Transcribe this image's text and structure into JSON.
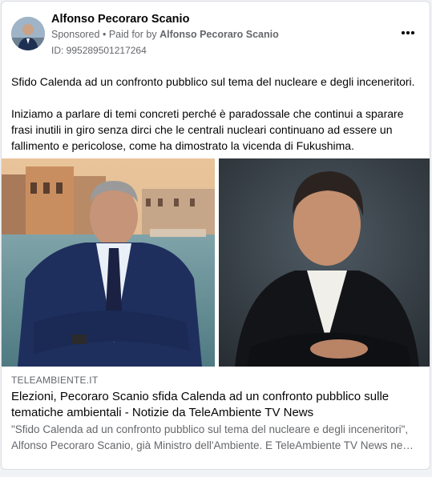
{
  "post": {
    "author": "Alfonso Pecoraro Scanio",
    "sponsored": "Sponsored",
    "paid_prefix": "Paid for by",
    "paid_by": "Alfonso Pecoraro Scanio",
    "separator": "•",
    "ad_id": "ID: 995289501217264",
    "more_icon": "more-horizontal-icon",
    "paragraph1": "Sfido Calenda ad un confronto pubblico sul tema del nucleare e degli inceneritori.",
    "paragraph2": "Iniziamo a parlare di temi concreti perché è paradossale che continui a sparare frasi inutili in giro senza dirci che le centrali nucleari continuano ad essere un fallimento e pericolose, come ha dimostrato la vicenda di Fukushima."
  },
  "link": {
    "domain": "TELEAMBIENTE.IT",
    "title": "Elezioni, Pecoraro Scanio sfida Calenda ad un confronto pubblico sulle tematiche ambientali - Notizie da TeleAmbiente TV News",
    "description": "\"Sfido Calenda ad un confronto pubblico sul tema del nucleare e degli inceneritori\", Alfonso Pecoraro Scanio, già Ministro dell'Ambiente. E TeleAmbiente TV News ne parla."
  },
  "colors": {
    "primary_text": "#050505",
    "secondary_text": "#65676b",
    "card_border": "#dadde1",
    "page_bg": "#f0f2f5"
  }
}
